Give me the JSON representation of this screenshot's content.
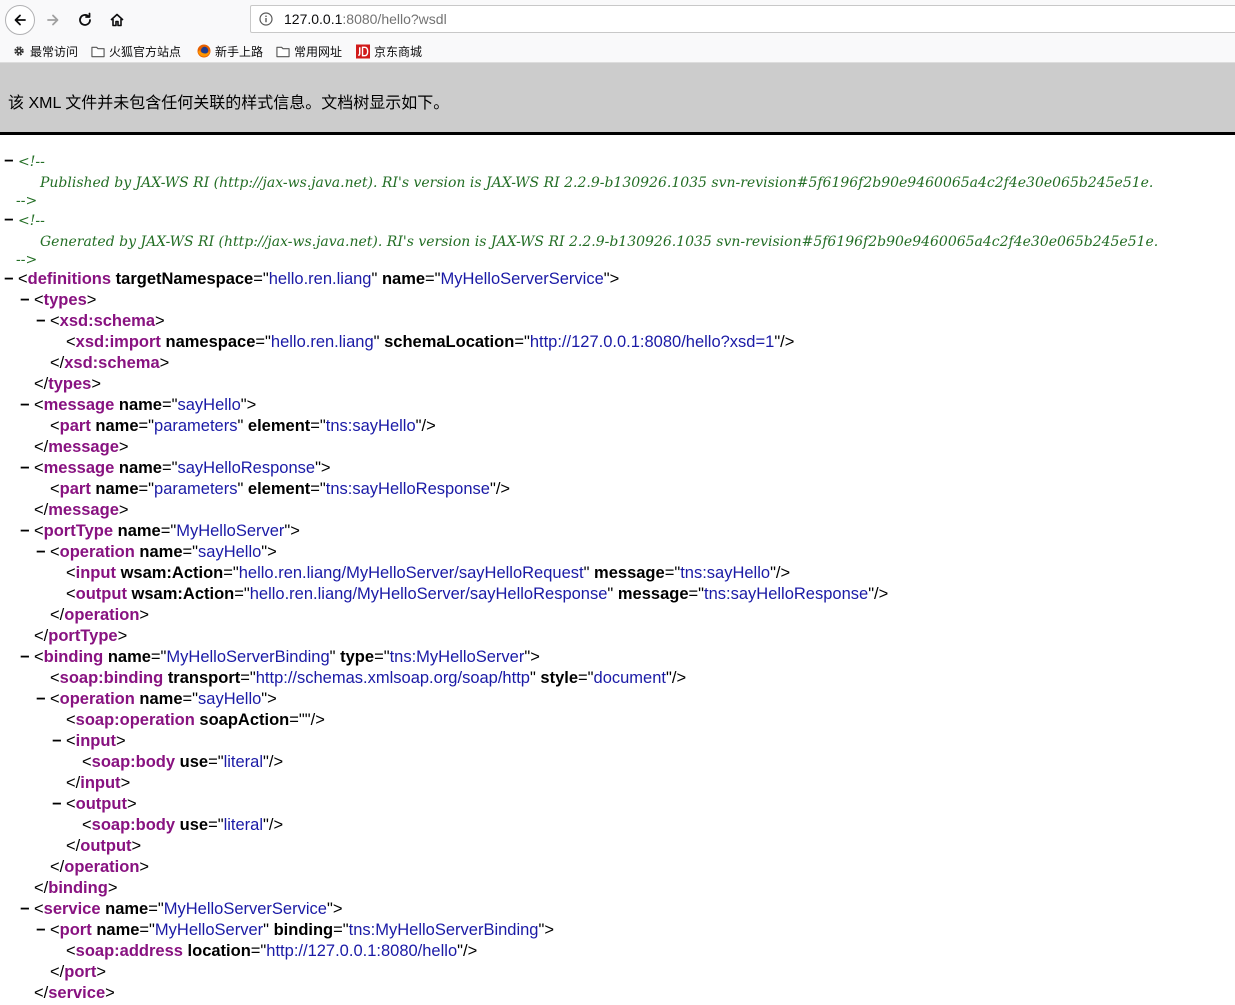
{
  "browser": {
    "url_host": "127.0.0.1",
    "url_path": ":8080/hello?wsdl",
    "bookmarks": [
      {
        "label": "最常访问",
        "icon": "gear-icon"
      },
      {
        "label": "火狐官方站点",
        "icon": "folder-icon"
      },
      {
        "label": "新手上路",
        "icon": "firefox-icon"
      },
      {
        "label": "常用网址",
        "icon": "folder-icon"
      },
      {
        "label": "京东商城",
        "icon": "jd-logo-icon"
      }
    ]
  },
  "banner": {
    "message": "该 XML 文件并未包含任何关联的样式信息。文档树显示如下。"
  },
  "xml": {
    "comments": [
      {
        "open": "<!--",
        "body": "Published by JAX-WS RI (http://jax-ws.java.net). RI's version is JAX-WS RI 2.2.9-b130926.1035 svn-revision#5f6196f2b90e9460065a4c2f4e30e065b245e51e.",
        "close": "-->"
      },
      {
        "open": "<!--",
        "body": "Generated by JAX-WS RI (http://jax-ws.java.net). RI's version is JAX-WS RI 2.2.9-b130926.1035 svn-revision#5f6196f2b90e9460065a4c2f4e30e065b245e51e.",
        "close": "-->"
      }
    ],
    "lines": [
      {
        "indent": 0,
        "toggle": true,
        "kind": "open",
        "tag": "definitions",
        "attrs": [
          [
            "targetNamespace",
            "hello.ren.liang"
          ],
          [
            "name",
            "MyHelloServerService"
          ]
        ]
      },
      {
        "indent": 1,
        "toggle": true,
        "kind": "open",
        "tag": "types",
        "attrs": []
      },
      {
        "indent": 2,
        "toggle": true,
        "kind": "open",
        "tag": "xsd:schema",
        "attrs": []
      },
      {
        "indent": 3,
        "toggle": false,
        "kind": "self",
        "tag": "xsd:import",
        "attrs": [
          [
            "namespace",
            "hello.ren.liang"
          ],
          [
            "schemaLocation",
            "http://127.0.0.1:8080/hello?xsd=1"
          ]
        ]
      },
      {
        "indent": 2,
        "toggle": false,
        "kind": "close",
        "tag": "xsd:schema",
        "attrs": []
      },
      {
        "indent": 1,
        "toggle": false,
        "kind": "close",
        "tag": "types",
        "attrs": []
      },
      {
        "indent": 1,
        "toggle": true,
        "kind": "open",
        "tag": "message",
        "attrs": [
          [
            "name",
            "sayHello"
          ]
        ]
      },
      {
        "indent": 2,
        "toggle": false,
        "kind": "self",
        "tag": "part",
        "attrs": [
          [
            "name",
            "parameters"
          ],
          [
            "element",
            "tns:sayHello"
          ]
        ]
      },
      {
        "indent": 1,
        "toggle": false,
        "kind": "close",
        "tag": "message",
        "attrs": []
      },
      {
        "indent": 1,
        "toggle": true,
        "kind": "open",
        "tag": "message",
        "attrs": [
          [
            "name",
            "sayHelloResponse"
          ]
        ]
      },
      {
        "indent": 2,
        "toggle": false,
        "kind": "self",
        "tag": "part",
        "attrs": [
          [
            "name",
            "parameters"
          ],
          [
            "element",
            "tns:sayHelloResponse"
          ]
        ]
      },
      {
        "indent": 1,
        "toggle": false,
        "kind": "close",
        "tag": "message",
        "attrs": []
      },
      {
        "indent": 1,
        "toggle": true,
        "kind": "open",
        "tag": "portType",
        "attrs": [
          [
            "name",
            "MyHelloServer"
          ]
        ]
      },
      {
        "indent": 2,
        "toggle": true,
        "kind": "open",
        "tag": "operation",
        "attrs": [
          [
            "name",
            "sayHello"
          ]
        ]
      },
      {
        "indent": 3,
        "toggle": false,
        "kind": "self",
        "tag": "input",
        "attrs": [
          [
            "wsam:Action",
            "hello.ren.liang/MyHelloServer/sayHelloRequest"
          ],
          [
            "message",
            "tns:sayHello"
          ]
        ]
      },
      {
        "indent": 3,
        "toggle": false,
        "kind": "self",
        "tag": "output",
        "attrs": [
          [
            "wsam:Action",
            "hello.ren.liang/MyHelloServer/sayHelloResponse"
          ],
          [
            "message",
            "tns:sayHelloResponse"
          ]
        ]
      },
      {
        "indent": 2,
        "toggle": false,
        "kind": "close",
        "tag": "operation",
        "attrs": []
      },
      {
        "indent": 1,
        "toggle": false,
        "kind": "close",
        "tag": "portType",
        "attrs": []
      },
      {
        "indent": 1,
        "toggle": true,
        "kind": "open",
        "tag": "binding",
        "attrs": [
          [
            "name",
            "MyHelloServerBinding"
          ],
          [
            "type",
            "tns:MyHelloServer"
          ]
        ]
      },
      {
        "indent": 2,
        "toggle": false,
        "kind": "self",
        "tag": "soap:binding",
        "attrs": [
          [
            "transport",
            "http://schemas.xmlsoap.org/soap/http"
          ],
          [
            "style",
            "document"
          ]
        ]
      },
      {
        "indent": 2,
        "toggle": true,
        "kind": "open",
        "tag": "operation",
        "attrs": [
          [
            "name",
            "sayHello"
          ]
        ]
      },
      {
        "indent": 3,
        "toggle": false,
        "kind": "self",
        "tag": "soap:operation",
        "attrs": [
          [
            "soapAction",
            ""
          ]
        ]
      },
      {
        "indent": 3,
        "toggle": true,
        "kind": "open",
        "tag": "input",
        "attrs": []
      },
      {
        "indent": 4,
        "toggle": false,
        "kind": "self",
        "tag": "soap:body",
        "attrs": [
          [
            "use",
            "literal"
          ]
        ]
      },
      {
        "indent": 3,
        "toggle": false,
        "kind": "close",
        "tag": "input",
        "attrs": []
      },
      {
        "indent": 3,
        "toggle": true,
        "kind": "open",
        "tag": "output",
        "attrs": []
      },
      {
        "indent": 4,
        "toggle": false,
        "kind": "self",
        "tag": "soap:body",
        "attrs": [
          [
            "use",
            "literal"
          ]
        ]
      },
      {
        "indent": 3,
        "toggle": false,
        "kind": "close",
        "tag": "output",
        "attrs": []
      },
      {
        "indent": 2,
        "toggle": false,
        "kind": "close",
        "tag": "operation",
        "attrs": []
      },
      {
        "indent": 1,
        "toggle": false,
        "kind": "close",
        "tag": "binding",
        "attrs": []
      },
      {
        "indent": 1,
        "toggle": true,
        "kind": "open",
        "tag": "service",
        "attrs": [
          [
            "name",
            "MyHelloServerService"
          ]
        ]
      },
      {
        "indent": 2,
        "toggle": true,
        "kind": "open",
        "tag": "port",
        "attrs": [
          [
            "name",
            "MyHelloServer"
          ],
          [
            "binding",
            "tns:MyHelloServerBinding"
          ]
        ]
      },
      {
        "indent": 3,
        "toggle": false,
        "kind": "self",
        "tag": "soap:address",
        "attrs": [
          [
            "location",
            "http://127.0.0.1:8080/hello"
          ]
        ]
      },
      {
        "indent": 2,
        "toggle": false,
        "kind": "close",
        "tag": "port",
        "attrs": []
      },
      {
        "indent": 1,
        "toggle": false,
        "kind": "close",
        "tag": "service",
        "attrs": []
      }
    ]
  },
  "colors": {
    "tag": "#881280",
    "attr_value": "#1a1aa6",
    "comment": "#236e25",
    "banner_bg": "#cccccc"
  }
}
